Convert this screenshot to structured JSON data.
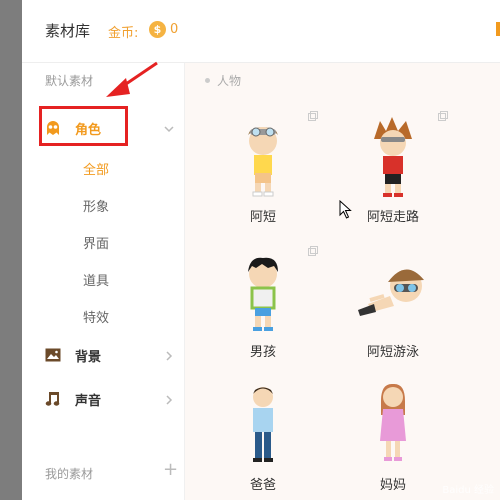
{
  "header": {
    "title": "素材库",
    "coin_label": "金币:",
    "coin_symbol": "$",
    "coin_count": "0"
  },
  "sidebar": {
    "default_label": "默认素材",
    "categories": [
      {
        "label": "角色",
        "icon": "ghost-character-icon",
        "expanded": true
      },
      {
        "label": "背景",
        "icon": "image-icon"
      },
      {
        "label": "声音",
        "icon": "music-note-icon"
      }
    ],
    "role_subitems": [
      "全部",
      "形象",
      "界面",
      "道具",
      "特效"
    ],
    "my_materials": "我的素材",
    "add_symbol": "+"
  },
  "content": {
    "breadcrumb": "人物",
    "items": [
      {
        "name": "阿短"
      },
      {
        "name": "阿短走路"
      },
      {
        "name": "男孩"
      },
      {
        "name": "阿短游泳"
      },
      {
        "name": "爸爸"
      },
      {
        "name": "妈妈"
      }
    ]
  },
  "watermark": "Baidu 经验",
  "colors": {
    "accent": "#f29a1e",
    "highlight_box": "#e52222",
    "arrow": "#e52222"
  }
}
